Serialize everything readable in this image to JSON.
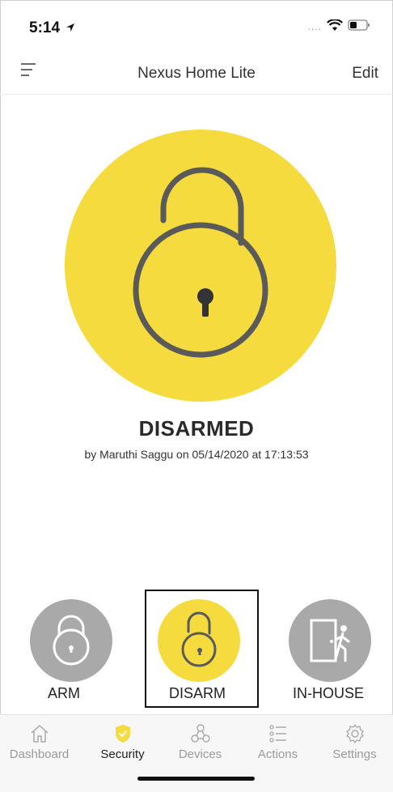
{
  "status_bar": {
    "time": "5:14"
  },
  "header": {
    "title": "Nexus Home Lite",
    "edit_label": "Edit"
  },
  "security": {
    "state": "DISARMED",
    "detail": "by Maruthi Saggu on 05/14/2020 at 17:13:53"
  },
  "modes": [
    {
      "label": "ARM",
      "selected": false
    },
    {
      "label": "DISARM",
      "selected": true
    },
    {
      "label": "IN-HOUSE",
      "selected": false
    }
  ],
  "tabs": [
    {
      "label": "Dashboard",
      "icon": "home-icon"
    },
    {
      "label": "Security",
      "icon": "shield-icon",
      "active": true
    },
    {
      "label": "Devices",
      "icon": "devices-icon"
    },
    {
      "label": "Actions",
      "icon": "list-icon"
    },
    {
      "label": "Settings",
      "icon": "gear-icon"
    }
  ],
  "colors": {
    "accent_yellow": "#F5DB3E",
    "inactive_gray": "#A9A9A9",
    "lock_stroke": "#5a5a5a"
  }
}
